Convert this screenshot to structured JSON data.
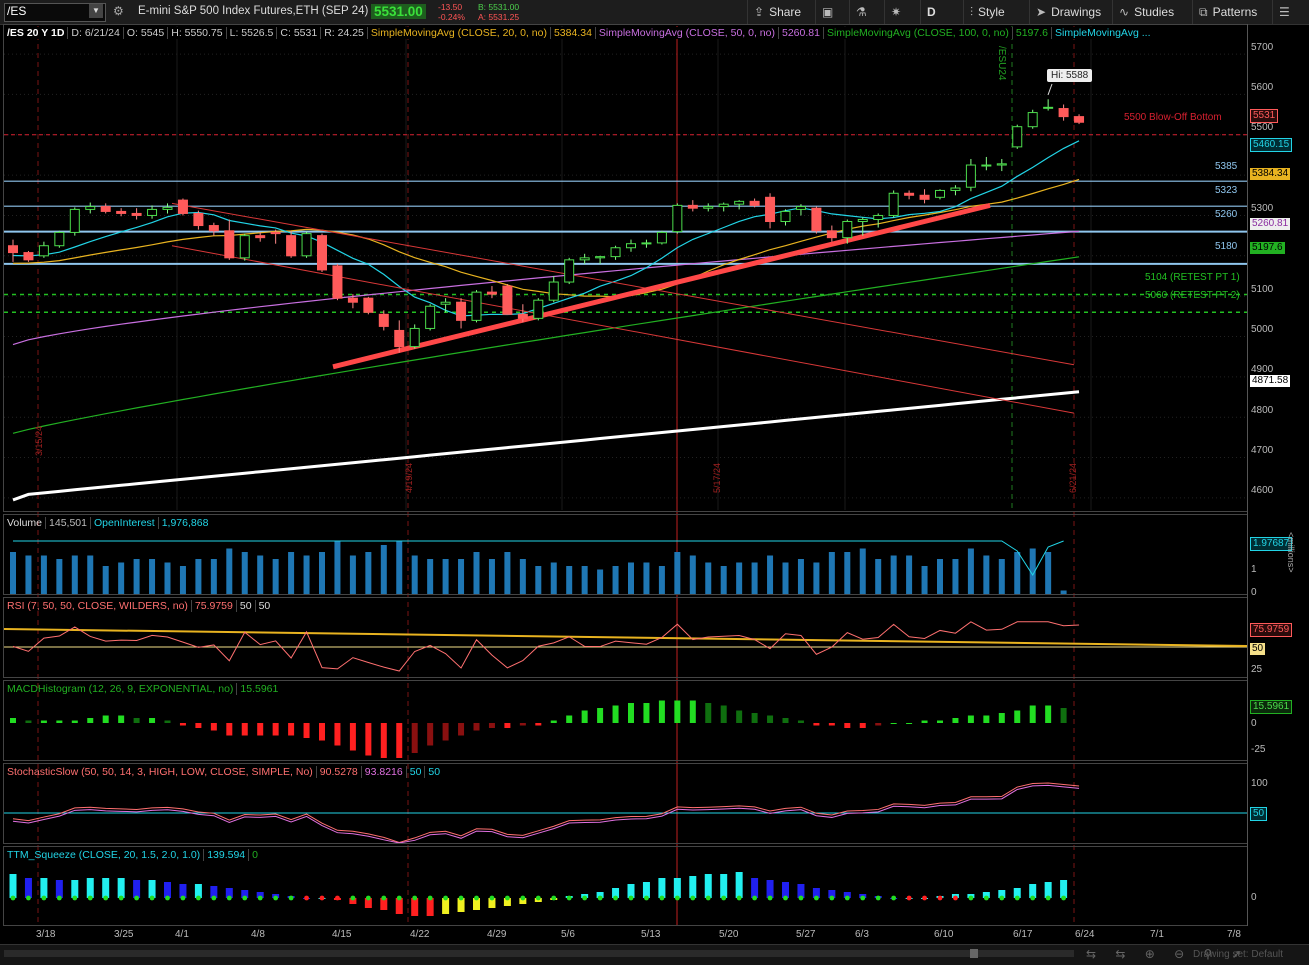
{
  "toolbar": {
    "symbol": "/ES",
    "description": "E-mini S&P 500 Index Futures,ETH (SEP 24)",
    "last": "5531.00",
    "net_change": "-13.50",
    "pct_change": "-0.24%",
    "bid": "B: 5531.00",
    "ask": "A: 5531.25",
    "share": "Share",
    "timeframe": "D",
    "style": "Style",
    "drawings": "Drawings",
    "studies": "Studies",
    "patterns": "Patterns"
  },
  "price_header": {
    "symbol_period": "/ES 20 Y 1D",
    "date": "D: 6/21/24",
    "open": "O: 5545",
    "high": "H: 5550.75",
    "low": "L: 5526.5",
    "close": "C: 5531",
    "range": "R: 24.25",
    "sma20_label": "SimpleMovingAvg (CLOSE, 20, 0, no)",
    "sma20_value": "5384.34",
    "sma50_label": "SimpleMovingAvg (CLOSE, 50, 0, no)",
    "sma50_value": "5260.81",
    "sma100_label": "SimpleMovingAvg (CLOSE, 100, 0, no)",
    "sma100_value": "5197.6",
    "sma_extra_label": "SimpleMovingAvg ..."
  },
  "annotations": {
    "hi_label": "Hi: 5588",
    "blowoff": "5500 Blow-Off Bottom",
    "l5385": "5385",
    "l5323": "5323",
    "l5260": "5260",
    "l5180": "5180",
    "retest1": "5104 (RETEST PT 1)",
    "retest2": "5060 (RETEST PT 2)",
    "contract": "/ESU24",
    "vdate1": "3/15/24",
    "vdate2": "4/19/24",
    "vdate3": "5/17/24",
    "vdate4": "6/21/24"
  },
  "price_axis": {
    "ticks": [
      "5700",
      "5600",
      "5500",
      "5300",
      "5200",
      "5100",
      "5000",
      "4900",
      "4800",
      "4700",
      "4600"
    ],
    "badges": {
      "last": "5531",
      "sma9": "5460.15",
      "sma20": "5384.34",
      "sma50": "5260.81",
      "sma100": "5197.6",
      "sma200": "4871.58"
    }
  },
  "volume_panel": {
    "title": "Volume",
    "value": "145,501",
    "oi_label": "OpenInterest",
    "oi_value": "1,976,868",
    "oi_badge": "1.97687",
    "tick1": "1",
    "tick0": "0",
    "unit": "<millions>"
  },
  "rsi_panel": {
    "title": "RSI (7, 50, 50, CLOSE, WILDERS, no)",
    "value": "75.9759",
    "ob": "50",
    "os": "50",
    "badge": "75.9759",
    "badge50": "50",
    "tick25": "25"
  },
  "macd_panel": {
    "title": "MACDHistogram (12, 26, 9, EXPONENTIAL, no)",
    "value": "15.5961",
    "badge": "15.5961",
    "tick0": "0",
    "tickm25": "-25"
  },
  "stoch_panel": {
    "title": "StochasticSlow (50, 50, 14, 3, HIGH, LOW, CLOSE, SIMPLE, No)",
    "k": "90.5278",
    "d": "93.8216",
    "l1": "50",
    "l2": "50",
    "tick100": "100",
    "badge50": "50"
  },
  "ttm_panel": {
    "title": "TTM_Squeeze (CLOSE, 20, 1.5, 2.0, 1.0)",
    "value": "139.594",
    "zero": "0",
    "tick0": "0"
  },
  "time_axis": [
    "3/18",
    "3/25",
    "4/1",
    "4/8",
    "4/15",
    "4/22",
    "4/29",
    "5/6",
    "5/13",
    "5/20",
    "5/27",
    "6/3",
    "6/10",
    "6/17",
    "6/24",
    "7/1",
    "7/8"
  ],
  "footer": {
    "drawing_set": "Drawing set: Default"
  },
  "chart_data": {
    "type": "candlestick",
    "ylim": [
      4570,
      5720
    ],
    "dates": [
      "3/14",
      "3/15",
      "3/18",
      "3/19",
      "3/20",
      "3/21",
      "3/22",
      "3/25",
      "3/26",
      "3/27",
      "3/28",
      "4/1",
      "4/2",
      "4/3",
      "4/4",
      "4/5",
      "4/8",
      "4/9",
      "4/10",
      "4/11",
      "4/12",
      "4/15",
      "4/16",
      "4/17",
      "4/18",
      "4/19",
      "4/22",
      "4/23",
      "4/24",
      "4/25",
      "4/26",
      "4/29",
      "4/30",
      "5/1",
      "5/2",
      "5/3",
      "5/6",
      "5/7",
      "5/8",
      "5/9",
      "5/10",
      "5/13",
      "5/14",
      "5/15",
      "5/16",
      "5/17",
      "5/20",
      "5/21",
      "5/22",
      "5/23",
      "5/24",
      "5/28",
      "5/29",
      "5/30",
      "5/31",
      "6/3",
      "6/4",
      "6/5",
      "6/6",
      "6/7",
      "6/10",
      "6/11",
      "6/12",
      "6/13",
      "6/14",
      "6/17",
      "6/18",
      "6/20",
      "6/21"
    ],
    "ohlc": [
      [
        5225,
        5240,
        5185,
        5208
      ],
      [
        5208,
        5212,
        5185,
        5190
      ],
      [
        5200,
        5235,
        5195,
        5225
      ],
      [
        5225,
        5262,
        5220,
        5258
      ],
      [
        5258,
        5320,
        5250,
        5315
      ],
      [
        5315,
        5332,
        5305,
        5322
      ],
      [
        5322,
        5330,
        5305,
        5310
      ],
      [
        5310,
        5318,
        5298,
        5305
      ],
      [
        5305,
        5318,
        5290,
        5300
      ],
      [
        5300,
        5325,
        5292,
        5315
      ],
      [
        5315,
        5330,
        5305,
        5320
      ],
      [
        5338,
        5342,
        5300,
        5305
      ],
      [
        5305,
        5312,
        5265,
        5275
      ],
      [
        5275,
        5282,
        5250,
        5262
      ],
      [
        5262,
        5290,
        5190,
        5195
      ],
      [
        5195,
        5255,
        5188,
        5250
      ],
      [
        5250,
        5258,
        5235,
        5245
      ],
      [
        5258,
        5265,
        5230,
        5255
      ],
      [
        5250,
        5262,
        5195,
        5200
      ],
      [
        5200,
        5260,
        5195,
        5255
      ],
      [
        5250,
        5255,
        5160,
        5165
      ],
      [
        5175,
        5180,
        5090,
        5095
      ],
      [
        5095,
        5105,
        5070,
        5085
      ],
      [
        5095,
        5098,
        5055,
        5060
      ],
      [
        5055,
        5065,
        5015,
        5025
      ],
      [
        5015,
        5040,
        4960,
        4975
      ],
      [
        4975,
        5030,
        4970,
        5020
      ],
      [
        5020,
        5080,
        5015,
        5075
      ],
      [
        5080,
        5095,
        5060,
        5085
      ],
      [
        5085,
        5095,
        5020,
        5040
      ],
      [
        5040,
        5115,
        5035,
        5110
      ],
      [
        5110,
        5125,
        5095,
        5105
      ],
      [
        5125,
        5130,
        5055,
        5055
      ],
      [
        5055,
        5080,
        5035,
        5045
      ],
      [
        5045,
        5095,
        5040,
        5090
      ],
      [
        5090,
        5150,
        5085,
        5135
      ],
      [
        5135,
        5195,
        5130,
        5190
      ],
      [
        5190,
        5205,
        5180,
        5195
      ],
      [
        5195,
        5200,
        5180,
        5198
      ],
      [
        5198,
        5225,
        5190,
        5220
      ],
      [
        5220,
        5240,
        5210,
        5230
      ],
      [
        5230,
        5240,
        5220,
        5232
      ],
      [
        5232,
        5262,
        5228,
        5258
      ],
      [
        5260,
        5330,
        5255,
        5325
      ],
      [
        5325,
        5338,
        5310,
        5318
      ],
      [
        5318,
        5330,
        5310,
        5322
      ],
      [
        5322,
        5332,
        5310,
        5328
      ],
      [
        5328,
        5338,
        5315,
        5335
      ],
      [
        5335,
        5342,
        5320,
        5325
      ],
      [
        5345,
        5355,
        5268,
        5285
      ],
      [
        5285,
        5315,
        5275,
        5310
      ],
      [
        5315,
        5328,
        5300,
        5322
      ],
      [
        5318,
        5322,
        5255,
        5262
      ],
      [
        5262,
        5275,
        5235,
        5245
      ],
      [
        5245,
        5290,
        5230,
        5285
      ],
      [
        5285,
        5295,
        5250,
        5290
      ],
      [
        5290,
        5305,
        5270,
        5300
      ],
      [
        5300,
        5362,
        5295,
        5355
      ],
      [
        5355,
        5362,
        5340,
        5350
      ],
      [
        5350,
        5365,
        5330,
        5340
      ],
      [
        5345,
        5365,
        5340,
        5362
      ],
      [
        5362,
        5375,
        5350,
        5368
      ],
      [
        5370,
        5440,
        5360,
        5425
      ],
      [
        5425,
        5445,
        5412,
        5425
      ],
      [
        5425,
        5440,
        5410,
        5428
      ],
      [
        5470,
        5525,
        5465,
        5520
      ],
      [
        5520,
        5562,
        5515,
        5555
      ],
      [
        5568,
        5588,
        5560,
        5568
      ],
      [
        5565,
        5575,
        5535,
        5545
      ],
      [
        5545,
        5550.75,
        5526.5,
        5531
      ]
    ],
    "studies": [
      "SMA 9",
      "SMA 20",
      "SMA 50",
      "SMA 100",
      "SMA 200"
    ],
    "series_last": {
      "sma9": 5460.15,
      "sma20": 5384.34,
      "sma50": 5260.81,
      "sma100": 5197.6,
      "sma200": 4871.58
    },
    "levels": [
      5500,
      5385,
      5323,
      5260,
      5180,
      5104,
      5060
    ],
    "subpanels": [
      "Volume",
      "RSI",
      "MACDHistogram",
      "StochasticSlow",
      "TTM_Squeeze"
    ]
  },
  "colors": {
    "up": "#4cdc4c",
    "down": "#ff5a5a",
    "sma9": "#22d4e6",
    "sma20": "#e8b320",
    "sma50": "#c86fe0",
    "sma100": "#22b022",
    "sma200": "#ffffff",
    "trend": "#ff4848",
    "level_blue": "#8fc6ee",
    "level_green": "#22c022",
    "level_red": "#d82030"
  }
}
